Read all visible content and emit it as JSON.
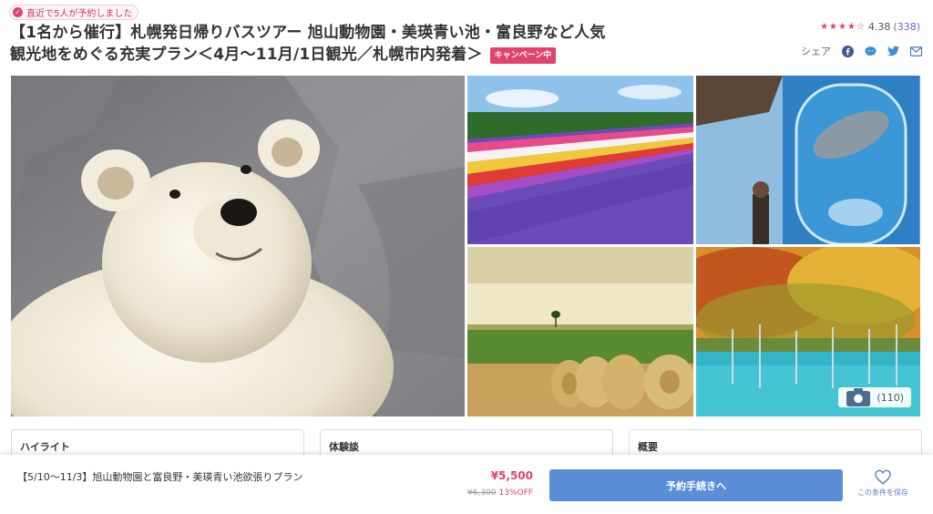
{
  "header": {
    "recent_badge": "直近で5人が予約しました",
    "title": "【1名から催行】札幌発日帰りバスツアー 旭山動物園・美瑛青い池・富良野など人気観光地をめぐる充実プラン＜4月～11月/1日観光／札幌市内発着＞",
    "campaign_badge": "キャンペーン中"
  },
  "rating": {
    "stars": 4,
    "value": "4.38",
    "count": "(338)",
    "color": "#e5416f"
  },
  "share": {
    "label": "シェア",
    "icons": [
      "facebook-icon",
      "line-icon",
      "twitter-icon",
      "mail-icon"
    ]
  },
  "gallery": {
    "photo_count": "(110)",
    "photos": [
      "polar-bear-photo",
      "lavender-field-photo",
      "seal-aquarium-photo",
      "hay-bale-field-photo",
      "blue-pond-autumn-photo"
    ]
  },
  "sections": {
    "highlight": "ハイライト",
    "experience": "体験談",
    "overview": "概要"
  },
  "booking_bar": {
    "plan_name": "【5/10～11/3】旭山動物園と富良野・美瑛青い池欲張りプラン",
    "price": "¥5,500",
    "original_price": "¥6,300",
    "discount": "13%OFF",
    "book_button": "予約手続きへ",
    "save_label": "この条件を保存"
  },
  "colors": {
    "accent": "#e5416f",
    "button": "#5b8ed7",
    "link": "#7a5ccc"
  }
}
